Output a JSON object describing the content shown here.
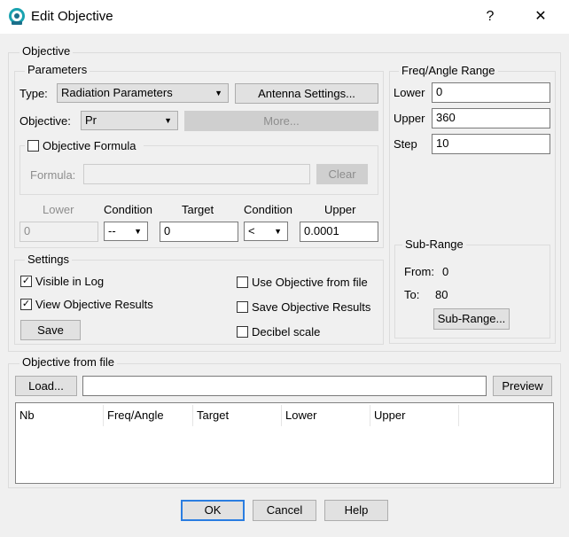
{
  "window": {
    "title": "Edit Objective",
    "help_glyph": "?",
    "close_glyph": "✕"
  },
  "objective_group": {
    "label": "Objective"
  },
  "parameters": {
    "label": "Parameters",
    "type_label": "Type:",
    "type_value": "Radiation Parameters",
    "antenna_settings": "Antenna Settings...",
    "objective_label": "Objective:",
    "objective_value": "Pr",
    "more": "More...",
    "formula_checkbox": "Objective Formula",
    "formula_checked": false,
    "formula_label": "Formula:",
    "formula_value": "",
    "clear": "Clear"
  },
  "condition_row": {
    "lower_label": "Lower",
    "condition1_label": "Condition",
    "target_label": "Target",
    "condition2_label": "Condition",
    "upper_label": "Upper",
    "lower_value": "0",
    "condition1_value": "--",
    "target_value": "0",
    "condition2_value": "<",
    "upper_value": "0.0001"
  },
  "settings": {
    "label": "Settings",
    "visible_in_log": "Visible in Log",
    "visible_in_log_checked": true,
    "view_results": "View Objective Results",
    "view_results_checked": true,
    "save": "Save",
    "use_from_file": "Use Objective from file",
    "use_from_file_checked": false,
    "save_results": "Save Objective Results",
    "save_results_checked": false,
    "decibel": "Decibel scale",
    "decibel_checked": false
  },
  "freq_range": {
    "label": "Freq/Angle Range",
    "lower_label": "Lower",
    "lower_value": "0",
    "upper_label": "Upper",
    "upper_value": "360",
    "step_label": "Step",
    "step_value": "10"
  },
  "sub_range": {
    "label": "Sub-Range",
    "from_label": "From:",
    "from_value": "0",
    "to_label": "To:",
    "to_value": "80",
    "button": "Sub-Range..."
  },
  "from_file": {
    "label": "Objective from file",
    "load": "Load...",
    "path_value": "",
    "preview": "Preview",
    "columns": [
      "Nb",
      "Freq/Angle",
      "Target",
      "Lower",
      "Upper"
    ]
  },
  "footer": {
    "ok": "OK",
    "cancel": "Cancel",
    "help": "Help"
  },
  "check_glyph": "✓"
}
